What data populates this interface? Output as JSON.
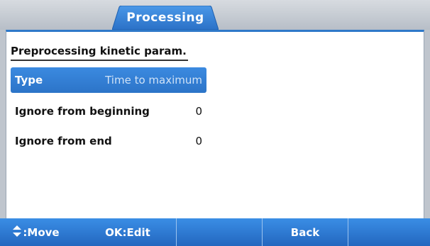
{
  "tab": {
    "label": "Processing"
  },
  "section": {
    "title": "Preprocessing kinetic param."
  },
  "rows": [
    {
      "label": "Type",
      "value": "Time to maximum",
      "selected": true
    },
    {
      "label": "Ignore from beginning",
      "value": "0",
      "selected": false
    },
    {
      "label": "Ignore from end",
      "value": "0",
      "selected": false
    }
  ],
  "softkeys": {
    "move_label": ":Move",
    "edit_label": "OK:Edit",
    "back_label": "Back"
  },
  "icons": {
    "move": "up-down-arrows-icon"
  },
  "colors": {
    "accent": "#2e79c9",
    "selected_row": "#3b8ae0",
    "softkey_bar": "#2a74cc"
  }
}
